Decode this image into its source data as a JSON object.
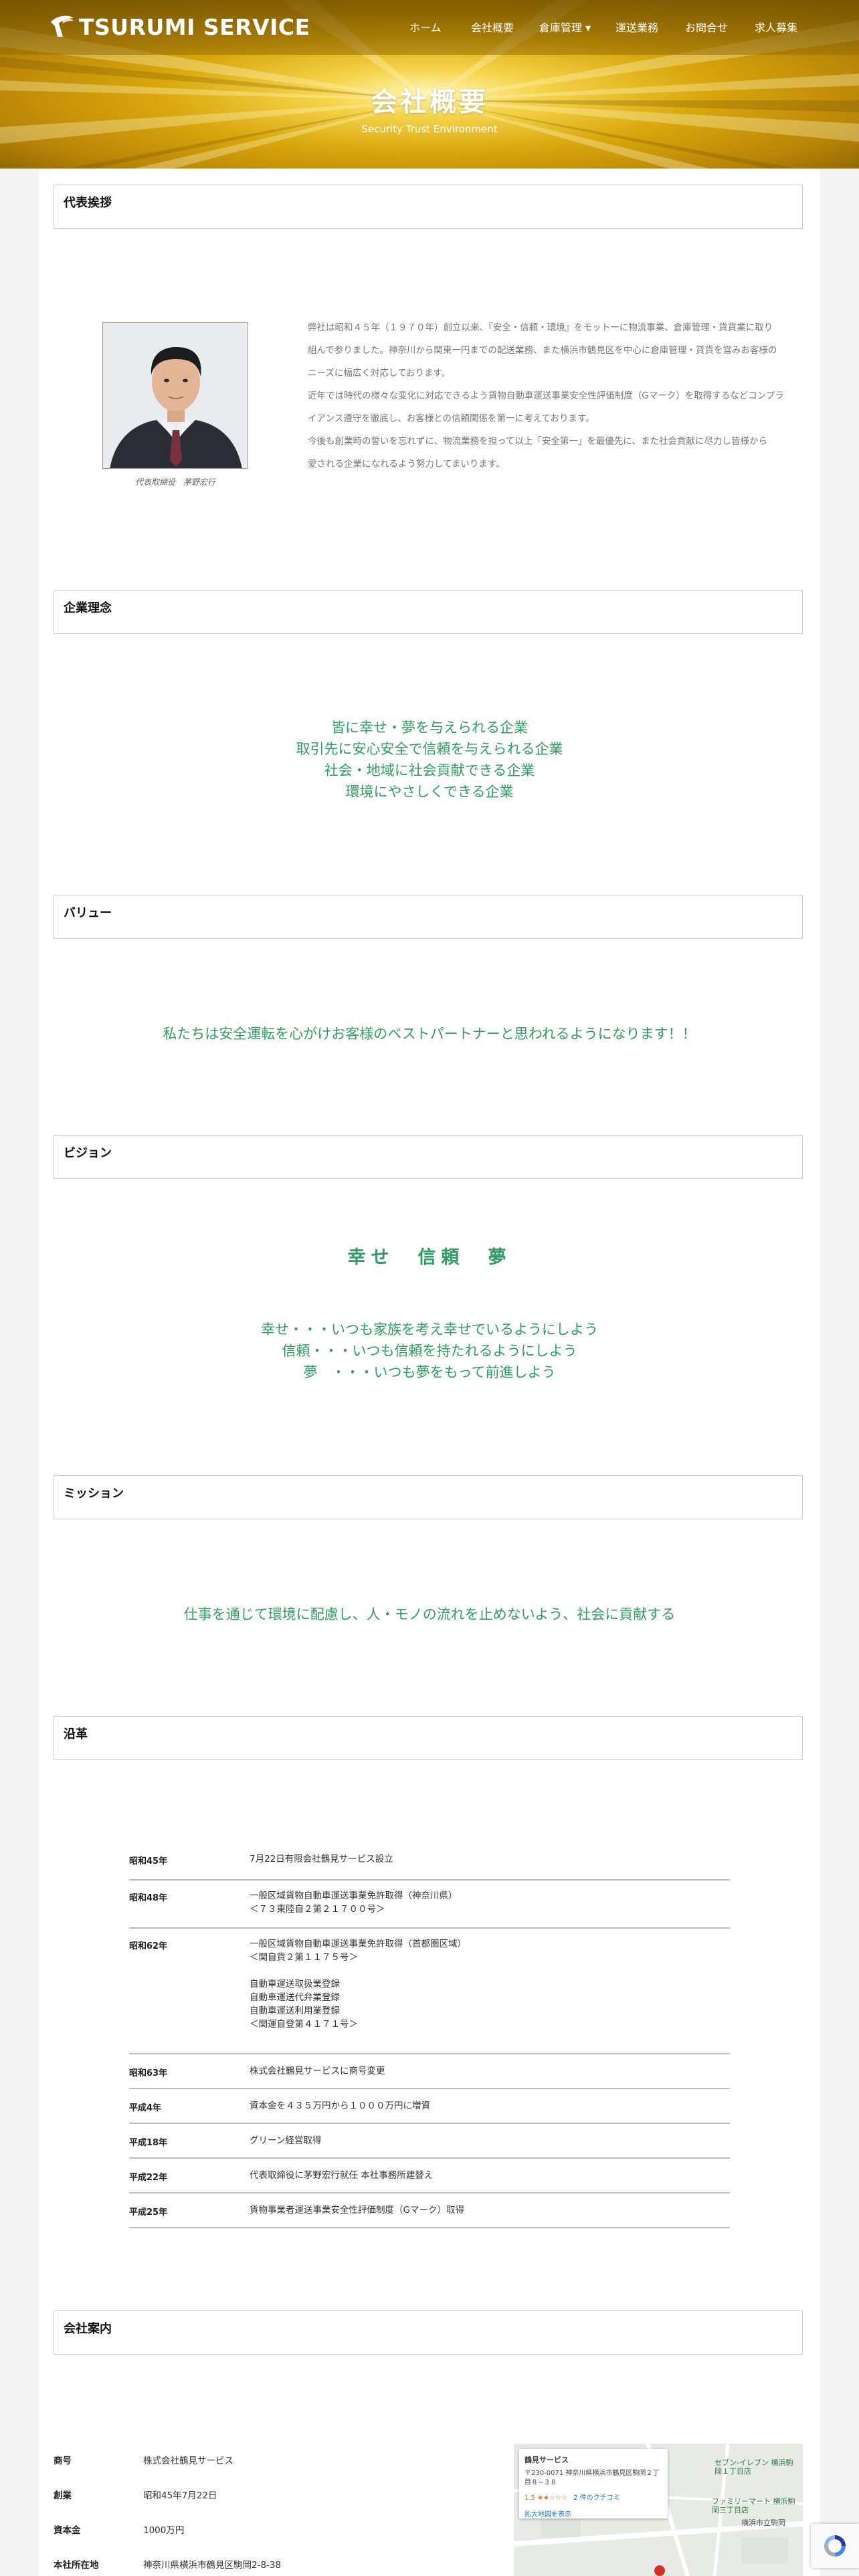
{
  "brand": {
    "name": "TSURUMI SERVICE"
  },
  "nav": {
    "items": [
      {
        "label": "ホーム"
      },
      {
        "label": "会社概要"
      },
      {
        "label": "倉庫管理 ▾"
      },
      {
        "label": "運送業務"
      },
      {
        "label": "お問合せ"
      },
      {
        "label": "求人募集"
      }
    ]
  },
  "hero": {
    "title": "会社概要",
    "subtitle": "Security Trust Environment"
  },
  "sections": {
    "greeting": "代表挨拶",
    "philosophy": "企業理念",
    "value": "バリュー",
    "vision": "ビジョン",
    "mission": "ミッション",
    "history": "沿革",
    "company": "会社案内"
  },
  "greeting": {
    "caption": "代表取締役　茅野宏行",
    "lines": [
      "弊社は昭和４５年（１９７０年）創立以来、『安全・信頼・環境』をモットーに物流事業、倉庫管理・貨貨業に取り",
      "組んで参りました。神奈川から関東一円までの配送業務、また横浜市鶴見区を中心に倉庫管理・貸貨を営みお客様の",
      "ニーズに幅広く対応しております。",
      "近年では時代の様々な変化に対応できるよう貨物自動車運送事業安全性評価制度（Gマーク）を取得するなどコンプラ",
      "イアンス遵守を徹底し、お客様との信頼関係を第一に考えております。",
      "今後も創業時の誓いを忘れずに、物流業務を担って以上「安全第一」を最優先に、また社会貢献に尽力し皆様から",
      "愛される企業になれるよう努力してまいります。"
    ]
  },
  "philosophy": {
    "lines": [
      "皆に幸せ・夢を与えられる企業",
      "取引先に安心安全で信頼を与えられる企業",
      "社会・地域に社会貢献できる企業",
      "環境にやさしくできる企業"
    ]
  },
  "value": {
    "text": "私たちは安全運転を心がけお客様のベストパートナーと思われるようになります！！"
  },
  "vision": {
    "title": "幸せ　信頼　夢",
    "lines": [
      "幸せ・・・いつも家族を考え幸せでいるようにしよう",
      "信頼・・・いつも信頼を持たれるようにしよう",
      "夢　・・・いつも夢をもって前進しよう"
    ]
  },
  "mission": {
    "text": "仕事を通じて環境に配慮し、人・モノの流れを止めないよう、社会に貢献する"
  },
  "history": [
    {
      "era": "昭和45年",
      "desc": "7月22日有限会社鶴見サービス設立"
    },
    {
      "era": "昭和48年",
      "desc": "一般区域貨物自動車運送事業免許取得（神奈川県）\n＜７３東陸自２第２１７００号＞"
    },
    {
      "era": "昭和62年",
      "desc": "一般区域貨物自動車運送事業免許取得（首都圏区域）\n＜関自貨２第１１７５号＞\n\n自動車運送取扱業登録\n自動車運送代弁業登録\n自動車運送利用業登録\n＜関運自登第４１７１号＞"
    },
    {
      "era": "昭和63年",
      "desc": "株式会社鶴見サービスに商号変更"
    },
    {
      "era": "平成4年",
      "desc": "資本金を４３５万円から１０００万円に増資"
    },
    {
      "era": "平成18年",
      "desc": "グリーン経営取得"
    },
    {
      "era": "平成22年",
      "desc": "代表取締役に茅野宏行就任 本社事務所建替え"
    },
    {
      "era": "平成25年",
      "desc": "貨物事業者運送事業安全性評価制度（Gマーク）取得"
    }
  ],
  "company": [
    {
      "key": "商号",
      "value": "株式会社鶴見サービス"
    },
    {
      "key": "創業",
      "value": "昭和45年7月22日"
    },
    {
      "key": "資本金",
      "value": "1000万円"
    },
    {
      "key": "本社所在地",
      "value": "神奈川県横浜市鶴見区駒岡2-8-38"
    }
  ],
  "map": {
    "place": "鶴見サービス",
    "address": "〒230-0071 神奈川県横浜市鶴見区駒岡２丁目８−３８",
    "rating": "1.5 ★★☆☆☆",
    "reviews": "2 件のクチコミ",
    "link": "拡大地図を表示",
    "poi1": "セブン-イレブン 横浜駒岡１丁目店",
    "poi2": "ファミリーマート 横浜駒岡三丁目店",
    "poi3": "横浜市立駒岡"
  }
}
